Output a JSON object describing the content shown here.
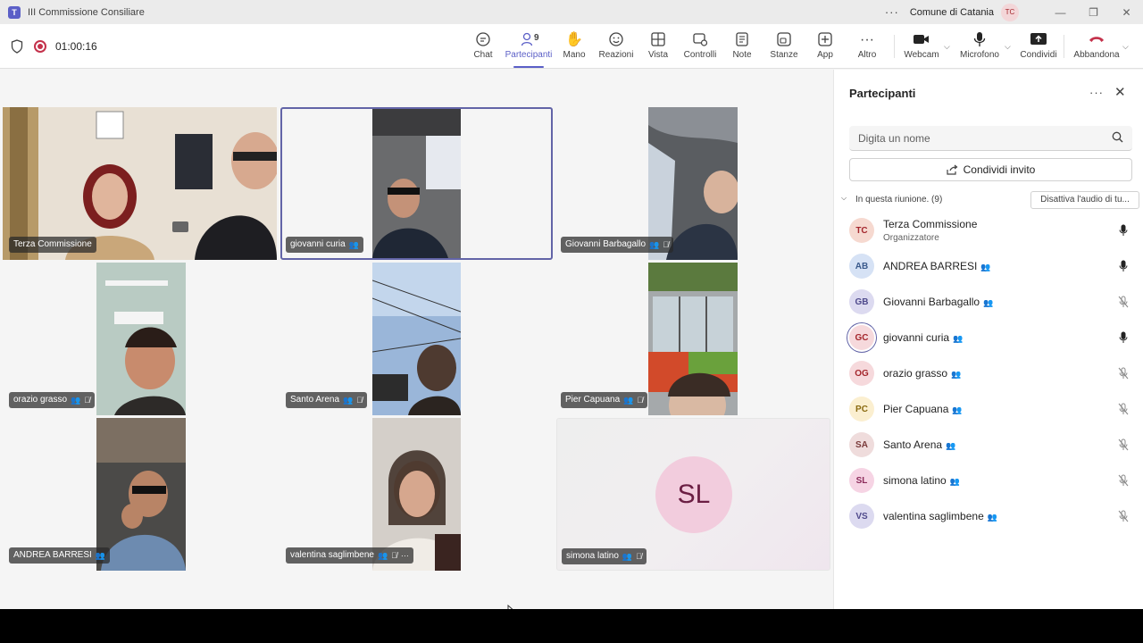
{
  "window": {
    "title": "III Commissione Consiliare",
    "org": "Comune di Catania",
    "user_initials": "TC",
    "menu_icon": "more-icon",
    "minimize": "—",
    "maximize": "❐",
    "close": "✕"
  },
  "meeting": {
    "elapsed": "01:00:16"
  },
  "toolbar": {
    "chat": "Chat",
    "participants": "Partecipanti",
    "participants_count": "9",
    "hand": "Mano",
    "reactions": "Reazioni",
    "view": "Vista",
    "controls": "Controlli",
    "notes": "Note",
    "rooms": "Stanze",
    "apps": "App",
    "more": "Altro",
    "webcam": "Webcam",
    "mic": "Microfono",
    "share": "Condividi",
    "leave": "Abbandona"
  },
  "tiles": [
    {
      "name": "Terza Commissione",
      "muted": false
    },
    {
      "name": "giovanni curia",
      "muted": false,
      "selected": true
    },
    {
      "name": "Giovanni Barbagallo",
      "muted": true
    },
    {
      "name": "orazio grasso",
      "muted": true
    },
    {
      "name": "Santo Arena",
      "muted": true
    },
    {
      "name": "Pier Capuana",
      "muted": true
    },
    {
      "name": "ANDREA BARRESI",
      "muted": false
    },
    {
      "name": "valentina saglimbene",
      "muted": true
    },
    {
      "name": "simona latino",
      "muted": true,
      "initials": "SL"
    }
  ],
  "sidebar": {
    "title": "Partecipanti",
    "search_placeholder": "Digita un nome",
    "share_invite": "Condividi invito",
    "section_label": "In questa riunione. (9)",
    "mute_all": "Disattiva l'audio di tu...",
    "participants": [
      {
        "initials": "TC",
        "name": "Terza Commissione",
        "role": "Organizzatore",
        "mic": "on",
        "color": "#f6d9d0",
        "text_color": "#a4262c"
      },
      {
        "initials": "AB",
        "name": "ANDREA BARRESI",
        "mic": "on",
        "color": "#d6e2f5",
        "text_color": "#3a5a8c"
      },
      {
        "initials": "GB",
        "name": "Giovanni Barbagallo",
        "mic": "off",
        "color": "#dcdaf0",
        "text_color": "#4f4a8c"
      },
      {
        "initials": "GC",
        "name": "giovanni curia",
        "mic": "on",
        "color": "#f6d9dc",
        "text_color": "#a4262c",
        "ring": true
      },
      {
        "initials": "OG",
        "name": "orazio grasso",
        "mic": "off",
        "color": "#f6d9dc",
        "text_color": "#a4262c"
      },
      {
        "initials": "PC",
        "name": "Pier Capuana",
        "mic": "off",
        "color": "#fbefd0",
        "text_color": "#8a6a10"
      },
      {
        "initials": "SA",
        "name": "Santo Arena",
        "mic": "off",
        "color": "#efdcdc",
        "text_color": "#7a3a3a"
      },
      {
        "initials": "SL",
        "name": "simona latino",
        "mic": "off",
        "color": "#f6d4e4",
        "text_color": "#8c2a5a"
      },
      {
        "initials": "VS",
        "name": "valentina saglimbene",
        "mic": "off",
        "color": "#dcdaf0",
        "text_color": "#4f4a8c"
      }
    ]
  }
}
